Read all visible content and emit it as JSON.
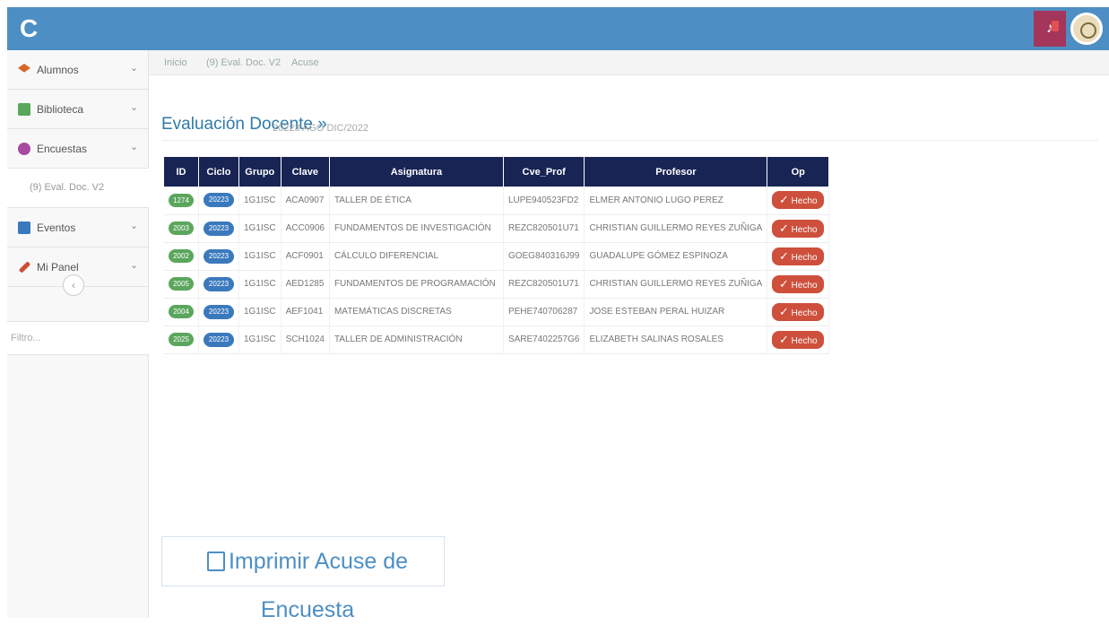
{
  "header": {
    "logo": "C",
    "notification_icon": "bell-icon",
    "profile_icon": "seal-avatar"
  },
  "sidebar": {
    "items": [
      {
        "label": "Alumnos",
        "icon": "graduation-icon",
        "color": "#d5652b"
      },
      {
        "label": "Biblioteca",
        "icon": "book-icon",
        "color": "#5ba65d"
      },
      {
        "label": "Encuestas",
        "icon": "chat-icon",
        "color": "#a64ba1"
      },
      {
        "label": "Eventos",
        "icon": "calendar-icon",
        "color": "#3b79bd"
      },
      {
        "label": "Mi Panel",
        "icon": "wrench-icon",
        "color": "#d04d33"
      }
    ],
    "submenu_item": "(9) Eval. Doc. V2",
    "collapse_icon": "chevron-left-icon",
    "filter_placeholder": "Filtro..."
  },
  "breadcrumb": {
    "home": "Inicio",
    "current": "(9) Eval. Doc. V2",
    "extra": "Acuse"
  },
  "page": {
    "title": "Evaluación Docente »",
    "subtitle": "20223 AGO DIC/2022"
  },
  "table": {
    "headers": [
      "ID",
      "Ciclo",
      "Grupo",
      "Clave",
      "Asignatura",
      "Cve_Prof",
      "Profesor",
      "Op"
    ],
    "done_label": "Hecho",
    "rows": [
      {
        "id": "1274",
        "cycle": "20223",
        "group": "1G1ISC",
        "code": "ACA0907",
        "subject": "TALLER DE ÉTICA",
        "prof_code": "LUPE940523FD2",
        "professor": "ELMER ANTONIO LUGO PEREZ"
      },
      {
        "id": "2003",
        "cycle": "20223",
        "group": "1G1ISC",
        "code": "ACC0906",
        "subject": "FUNDAMENTOS DE INVESTIGACIÓN",
        "prof_code": "REZC820501U71",
        "professor": "CHRISTIAN GUILLERMO REYES ZUÑIGA"
      },
      {
        "id": "2002",
        "cycle": "20223",
        "group": "1G1ISC",
        "code": "ACF0901",
        "subject": "CÁLCULO DIFERENCIAL",
        "prof_code": "GOEG840316J99",
        "professor": "GUADALUPE GÓMEZ ESPINOZA"
      },
      {
        "id": "2005",
        "cycle": "20223",
        "group": "1G1ISC",
        "code": "AED1285",
        "subject": "FUNDAMENTOS DE PROGRAMACIÓN",
        "prof_code": "REZC820501U71",
        "professor": "CHRISTIAN GUILLERMO REYES ZUÑIGA"
      },
      {
        "id": "2004",
        "cycle": "20223",
        "group": "1G1ISC",
        "code": "AEF1041",
        "subject": "MATEMÁTICAS DISCRETAS",
        "prof_code": "PEHE740706287",
        "professor": "JOSE ESTEBAN PERAL HUIZAR"
      },
      {
        "id": "2025",
        "cycle": "20223",
        "group": "1G1ISC",
        "code": "SCH1024",
        "subject": "TALLER DE ADMINISTRACIÓN",
        "prof_code": "SARE7402257G6",
        "professor": "ELIZABETH SALINAS ROSALES"
      }
    ]
  },
  "print_button": {
    "label": "Imprimir Acuse de Encuesta",
    "icon": "save-icon"
  },
  "colors": {
    "topbar": "#4d8fc4",
    "table_header": "#172454",
    "done": "#ce4f3b",
    "id_pill": "#5ba65d",
    "cycle_pill": "#3b79bd",
    "notification": "#a3365a"
  }
}
